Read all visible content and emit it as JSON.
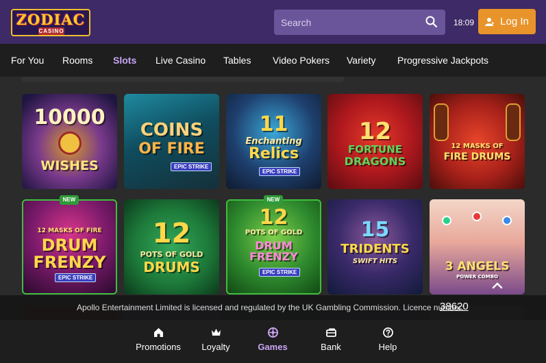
{
  "header": {
    "logo_main": "ZODIAC",
    "logo_sub": "CASINO",
    "search_placeholder": "Search",
    "time": "18:09",
    "login_label": "Log In"
  },
  "nav": {
    "items": [
      "For You",
      "Rooms",
      "Slots",
      "Live Casino",
      "Tables",
      "Video Pokers",
      "Variety",
      "Progressive Jackpots"
    ],
    "active": "Slots"
  },
  "games": [
    {
      "title_top": "10000",
      "title_bottom": "WISHES",
      "new": false
    },
    {
      "title_top": "COINS",
      "title_bottom": "OF FIRE",
      "tag": "EPIC STRIKE",
      "new": false
    },
    {
      "title_top": "11",
      "title_mid": "Enchanting",
      "title_bottom": "Relics",
      "tag": "EPIC STRIKE",
      "new": false
    },
    {
      "title_top": "12",
      "title_mid": "FORTUNE",
      "title_bottom": "DRAGONS",
      "new": false
    },
    {
      "title_top": "12 MASKS OF",
      "title_bottom": "FIRE DRUMS",
      "new": false
    },
    {
      "title_top": "12 MASKS OF FIRE",
      "title_mid": "DRUM",
      "title_bottom": "FRENZY",
      "tag": "EPIC STRIKE",
      "new": true
    },
    {
      "title_top": "12",
      "title_mid": "POTS OF GOLD",
      "title_bottom": "DRUMS",
      "new": false
    },
    {
      "title_top": "12",
      "title_mid": "POTS OF GOLD",
      "title_bottom": "DRUM FRENZY",
      "tag": "EPIC STRIKE",
      "new": true
    },
    {
      "title_top": "15",
      "title_mid": "TRIDENTS",
      "title_bottom": "SWIFT HITS",
      "new": false
    },
    {
      "title_top": "3 ANGELS",
      "title_bottom": "POWER COMBO",
      "new": false
    }
  ],
  "badge_new": "NEW",
  "licence": {
    "text": "Apollo Entertainment Limited is licensed and regulated by the UK Gambling Commission. Licence number:",
    "number": "38620"
  },
  "bottom_nav": {
    "items": [
      "Promotions",
      "Loyalty",
      "Games",
      "Bank",
      "Help"
    ],
    "active": "Games"
  },
  "colors": {
    "header_bg": "#3d2a66",
    "search_bg": "#6b559a",
    "login_bg": "#e8942a",
    "nav_bg": "#1e1e1e",
    "active_accent": "#c9a6f5",
    "new_badge": "#2e9a38",
    "page_bg": "#2b2b2b"
  },
  "icons": [
    "search-icon",
    "user-icon",
    "home-icon",
    "crown-icon",
    "games-icon",
    "bank-icon",
    "help-icon",
    "chevron-up-icon"
  ]
}
